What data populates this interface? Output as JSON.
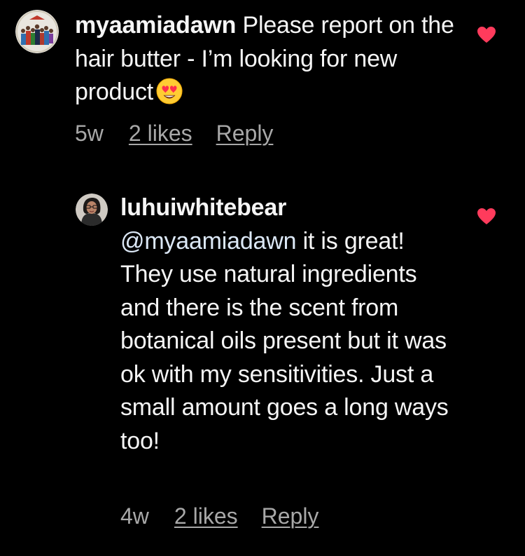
{
  "colors": {
    "background": "#000000",
    "text": "#f5f5f5",
    "secondary_text": "#a8a8a8",
    "mention": "#dbe7f5",
    "heart": "#ff3b5c"
  },
  "comments": [
    {
      "username": "myaamiadawn",
      "text": "Please report on the hair butter - I’m looking for new product",
      "emoji": "smiling-face-with-heart-eyes",
      "age": "5w",
      "likes_label": "2 likes",
      "reply_label": "Reply",
      "liked": true,
      "avatar_icon": "avatar-group-figures"
    },
    {
      "username": "luhuiwhitebear",
      "mention": "@myaamiadawn",
      "text": "it is great! They use natural ingredients and there is the scent from botanical oils present but it was ok with my sensitivities. Just a small amount goes a long ways too!",
      "age": "4w",
      "likes_label": "2 likes",
      "reply_label": "Reply",
      "liked": true,
      "avatar_icon": "avatar-person-photo"
    }
  ]
}
